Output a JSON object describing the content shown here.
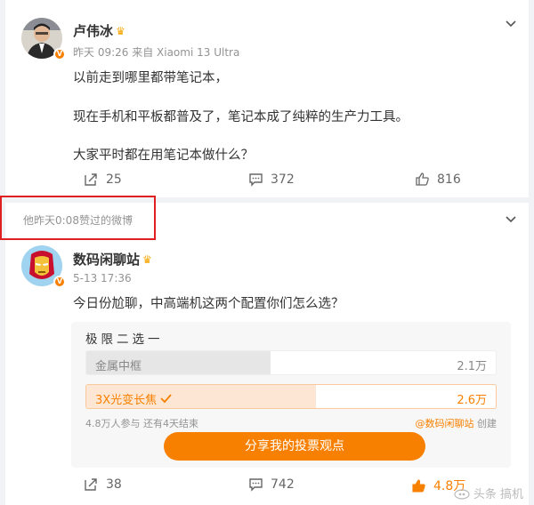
{
  "post1": {
    "author": "卢伟冰",
    "meta": "昨天 09:26 来自 Xiaomi 13 Ultra",
    "lines": [
      "以前走到哪里都带笔记本，",
      "现在手机和平板都普及了，笔记本成了纯粹的生产力工具。",
      "大家平时都在用笔记本做什么？"
    ],
    "reposts": "25",
    "comments": "372",
    "likes": "816"
  },
  "post2": {
    "liked_note": "他昨天0:08赞过的微博",
    "author": "数码闲聊站",
    "meta": "5-13 17:36",
    "text": "今日份尬聊，中高端机这两个配置你们怎么选？",
    "poll": {
      "title": "极限二选一",
      "options": [
        {
          "label": "金属中框",
          "count": "2.1万",
          "share": 0.45,
          "selected": false
        },
        {
          "label": "3X光变长焦",
          "count": "2.6万",
          "share": 0.56,
          "selected": true
        }
      ],
      "info": "4.8万人参与 还有4天结束",
      "creator_handle": "@数码闲聊站",
      "creator_suffix": " 创建",
      "share_button": "分享我的投票观点"
    },
    "reposts": "38",
    "comments": "742",
    "likes": "4.8万"
  },
  "watermark": "头条 搞机",
  "colors": {
    "accent": "#f78000",
    "highlight_box": "#e02020"
  }
}
